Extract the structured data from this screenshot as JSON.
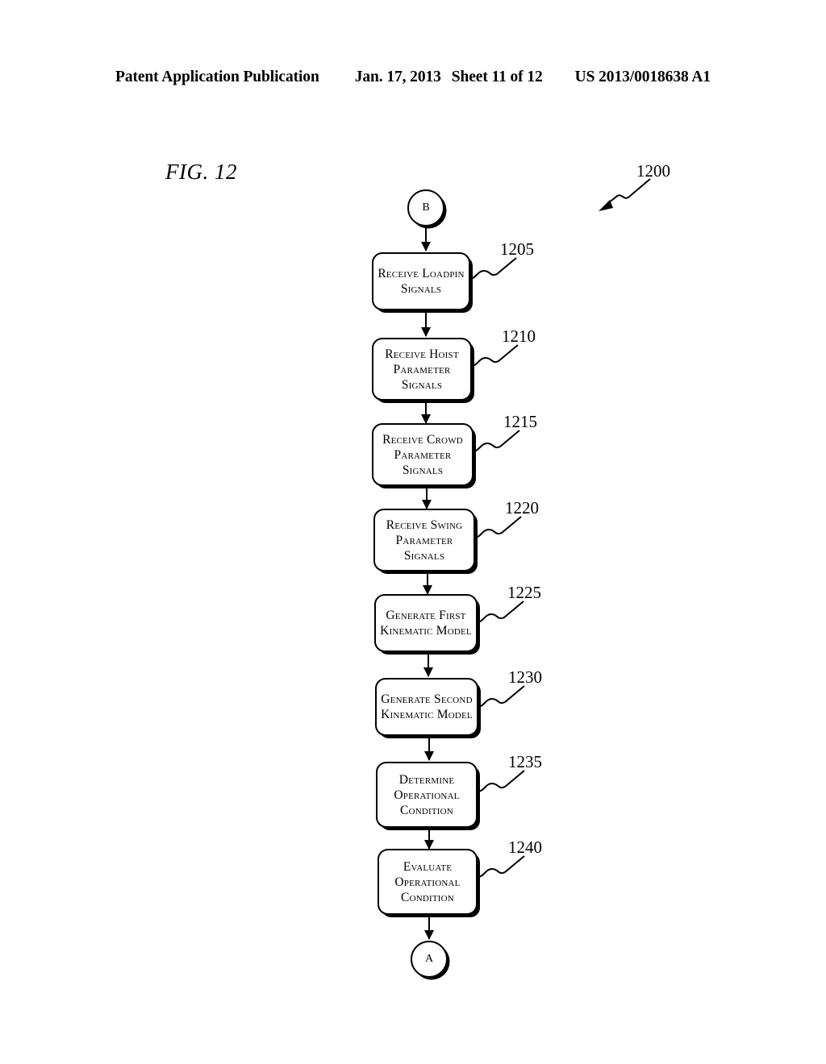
{
  "header": {
    "publication": "Patent Application Publication",
    "date": "Jan. 17, 2013",
    "sheet": "Sheet 11 of 12",
    "document_number": "US 2013/0018638 A1"
  },
  "figure": {
    "label": "FIG. 12",
    "reference": "1200"
  },
  "flowchart": {
    "start_connector": "B",
    "end_connector": "A",
    "steps": [
      {
        "ref": "1205",
        "lines": [
          "Receive Loadpin",
          "Signals"
        ]
      },
      {
        "ref": "1210",
        "lines": [
          "Receive Hoist",
          "Parameter",
          "Signals"
        ]
      },
      {
        "ref": "1215",
        "lines": [
          "Receive Crowd",
          "Parameter",
          "Signals"
        ]
      },
      {
        "ref": "1220",
        "lines": [
          "Receive Swing",
          "Parameter",
          "Signals"
        ]
      },
      {
        "ref": "1225",
        "lines": [
          "Generate First",
          "Kinematic Model"
        ]
      },
      {
        "ref": "1230",
        "lines": [
          "Generate Second",
          "Kinematic Model"
        ]
      },
      {
        "ref": "1235",
        "lines": [
          "Determine",
          "Operational",
          "Condition"
        ]
      },
      {
        "ref": "1240",
        "lines": [
          "Evaluate",
          "Operational",
          "Condition"
        ]
      }
    ]
  },
  "colors": {
    "ink": "#000000",
    "paper": "#ffffff"
  }
}
